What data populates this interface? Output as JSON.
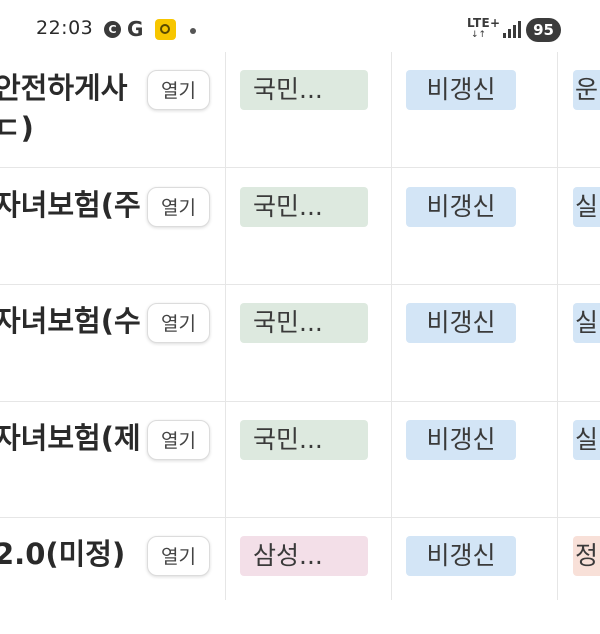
{
  "status_bar": {
    "time": "22:03",
    "notif_c": "C",
    "notif_g": "G",
    "network": "LTE+",
    "network_arrows": "↓↑",
    "battery": "95"
  },
  "colors": {
    "green_tag": "#dde9df",
    "blue_tag": "#d3e5f6",
    "pink_tag": "#f3dfe8",
    "peach_tag": "#f8e0d8"
  },
  "open_label": "열기",
  "rows": [
    {
      "name_line1": "안전하게사",
      "name_line2": "ㄷ)",
      "owner": "국민...",
      "owner_color": "green",
      "type": "비갱신",
      "next": "운",
      "next_color": "blue"
    },
    {
      "name_line1": "자녀보험(주",
      "name_line2": "",
      "owner": "국민...",
      "owner_color": "green",
      "type": "비갱신",
      "next": "실",
      "next_color": "blue"
    },
    {
      "name_line1": "자녀보험(수",
      "name_line2": "",
      "owner": "국민...",
      "owner_color": "green",
      "type": "비갱신",
      "next": "실",
      "next_color": "blue"
    },
    {
      "name_line1": "자녀보험(제",
      "name_line2": "",
      "owner": "국민...",
      "owner_color": "green",
      "type": "비갱신",
      "next": "실",
      "next_color": "blue"
    },
    {
      "name_line1": "2.0(미정)",
      "name_line2": "",
      "owner": "삼성...",
      "owner_color": "pink",
      "type": "비갱신",
      "next": "정",
      "next_color": "peach"
    }
  ]
}
